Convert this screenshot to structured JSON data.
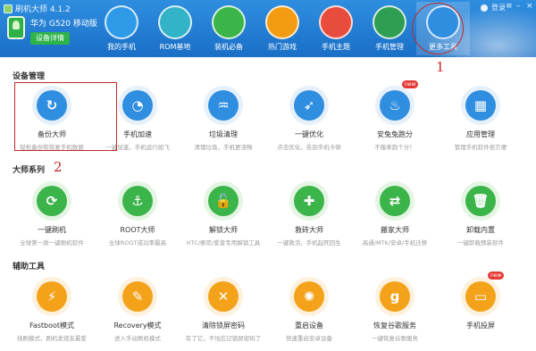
{
  "app": {
    "title": "刷机大师 4.1.2",
    "user_label": "登录"
  },
  "device": {
    "name": "华为 G520 移动版",
    "detail_button": "设备详情"
  },
  "nav": [
    {
      "label": "我的手机",
      "icon": "cloud-phone-icon",
      "active": false
    },
    {
      "label": "ROM基地",
      "icon": "shopping-bag-icon",
      "active": false
    },
    {
      "label": "装机必备",
      "icon": "apps-grid-icon",
      "active": false
    },
    {
      "label": "热门游戏",
      "icon": "gamepad-icon",
      "active": false
    },
    {
      "label": "手机主题",
      "icon": "tshirt-icon",
      "active": false
    },
    {
      "label": "手机管理",
      "icon": "shield-icon",
      "active": false
    },
    {
      "label": "更多工具",
      "icon": "gear-icon",
      "active": true
    }
  ],
  "annotations": {
    "one": "1",
    "two": "2"
  },
  "sections": [
    {
      "title": "设备管理",
      "items": [
        {
          "name": "备份大师",
          "desc": "轻松备份和恢复手机数据",
          "icon": "restore-icon",
          "glyph": "↻",
          "color": "blue",
          "badge": ""
        },
        {
          "name": "手机加速",
          "desc": "一键加速，手机运行如飞",
          "icon": "speedometer-icon",
          "glyph": "◔",
          "color": "blue",
          "badge": ""
        },
        {
          "name": "垃圾清理",
          "desc": "清理垃圾，手机更流畅",
          "icon": "broom-icon",
          "glyph": "♒",
          "color": "blue",
          "badge": ""
        },
        {
          "name": "一键优化",
          "desc": "点击优化，告别手机卡顿",
          "icon": "rocket-icon",
          "glyph": "➶",
          "color": "blue",
          "badge": ""
        },
        {
          "name": "安兔兔跑分",
          "desc": "不服来跑个分！",
          "icon": "flame-icon",
          "glyph": "♨",
          "color": "blue",
          "badge": "new"
        },
        {
          "name": "应用管理",
          "desc": "管理手机软件很方便",
          "icon": "app-grid-icon",
          "glyph": "▦",
          "color": "blue",
          "badge": ""
        }
      ]
    },
    {
      "title": "大师系列",
      "items": [
        {
          "name": "一键刷机",
          "desc": "全球第一款一键刷机软件",
          "icon": "refresh-icon",
          "glyph": "⟳",
          "color": "green",
          "badge": ""
        },
        {
          "name": "ROOT大师",
          "desc": "全球ROOT成功率最高",
          "icon": "anchor-icon",
          "glyph": "⚓",
          "color": "green",
          "badge": ""
        },
        {
          "name": "解锁大师",
          "desc": "HTC/索尼/爱普专用解锁工具",
          "icon": "unlock-icon",
          "glyph": "🔓",
          "color": "green",
          "badge": ""
        },
        {
          "name": "救砖大师",
          "desc": "一键救活，手机起死回生",
          "icon": "phone-plus-icon",
          "glyph": "✚",
          "color": "green",
          "badge": ""
        },
        {
          "name": "搬家大师",
          "desc": "高通/MTK/安卓/手机迁移",
          "icon": "transfer-icon",
          "glyph": "⇄",
          "color": "green",
          "badge": ""
        },
        {
          "name": "卸载内置",
          "desc": "一键卸载预装软件",
          "icon": "trash-icon",
          "glyph": "🗑",
          "color": "green",
          "badge": ""
        }
      ]
    },
    {
      "title": "辅助工具",
      "items": [
        {
          "name": "Fastboot模式",
          "desc": "线刷模式，刷机发烧友最爱",
          "icon": "lightning-icon",
          "glyph": "⚡",
          "color": "orange",
          "badge": ""
        },
        {
          "name": "Recovery模式",
          "desc": "进入手动刷机模式",
          "icon": "phone-edit-icon",
          "glyph": "✎",
          "color": "orange",
          "badge": ""
        },
        {
          "name": "清除锁屏密码",
          "desc": "有了它，不怕忘记锁屏密码了",
          "icon": "pattern-icon",
          "glyph": "✕",
          "color": "orange",
          "badge": ""
        },
        {
          "name": "重启设备",
          "desc": "快速重启安卓设备",
          "icon": "loading-icon",
          "glyph": "✺",
          "color": "orange",
          "badge": ""
        },
        {
          "name": "恢复谷歌服务",
          "desc": "一键恢复谷歌服务",
          "icon": "google-icon",
          "glyph": "g",
          "color": "orange",
          "badge": ""
        },
        {
          "name": "手机投屏",
          "desc": "",
          "icon": "laptop-icon",
          "glyph": "▭",
          "color": "orange",
          "badge": "new"
        }
      ]
    }
  ],
  "colors": {
    "header": "#1a6fc6",
    "accent_blue": "#2f8ee0",
    "accent_green": "#3bb44a",
    "accent_orange": "#f3a21a",
    "annotation": "#c62828"
  }
}
